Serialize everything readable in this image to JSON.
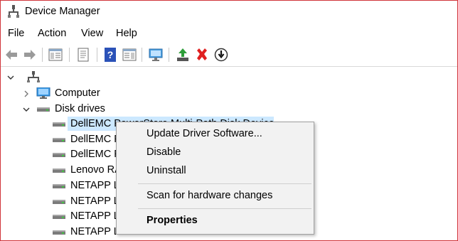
{
  "window": {
    "title": "Device Manager"
  },
  "menu": {
    "items": [
      "File",
      "Action",
      "View",
      "Help"
    ]
  },
  "toolbar": {
    "buttons": [
      "back-icon",
      "forward-icon",
      "show-hide-console-tree-icon",
      "properties-icon",
      "help-icon",
      "action-pane-icon",
      "scan-hardware-icon",
      "update-driver-icon",
      "uninstall-icon",
      "disable-icon"
    ]
  },
  "tree": {
    "computer_label": "Computer",
    "disk_drives_label": "Disk drives",
    "devices": [
      "DellEMC PowerStore Multi-Path Disk Device",
      "DellEMC P",
      "DellEMC P",
      "Lenovo RA",
      "NETAPP L",
      "NETAPP L",
      "NETAPP L",
      "NETAPP LUN C-Mode  Multi-Path Disk Device"
    ]
  },
  "context_menu": {
    "update_driver": "Update Driver Software...",
    "disable": "Disable",
    "uninstall": "Uninstall",
    "scan": "Scan for hardware changes",
    "properties": "Properties"
  },
  "colors": {
    "window_border": "#d0343a",
    "selection": "#cce8ff",
    "menu_background": "#f2f2f2",
    "help_icon_blue": "#2b52b8",
    "uninstall_red": "#e02020"
  }
}
